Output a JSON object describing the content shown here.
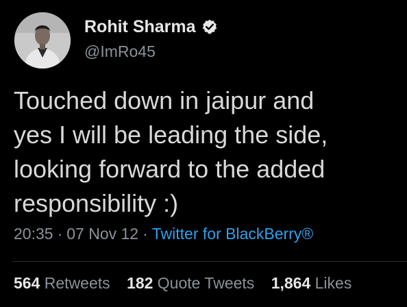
{
  "author": {
    "display_name": "Rohit Sharma",
    "handle": "@ImRo45",
    "verified_icon": "verified-badge-icon",
    "avatar_icon": "profile-photo"
  },
  "tweet": {
    "text": "Touched down in jaipur and\nyes I will be leading the side,\nlooking forward to the added\nresponsibility :)",
    "time": "20:35",
    "date": "07 Nov 12",
    "separator": "·",
    "source": "Twitter for BlackBerry®"
  },
  "stats": {
    "retweets_count": "564",
    "retweets_label": "Retweets",
    "quotes_count": "182",
    "quotes_label": "Quote Tweets",
    "likes_count": "1,864",
    "likes_label": "Likes"
  },
  "colors": {
    "background": "#000000",
    "text": "#d9d9d9",
    "muted": "#8b9299",
    "link": "#2ea1ec"
  }
}
